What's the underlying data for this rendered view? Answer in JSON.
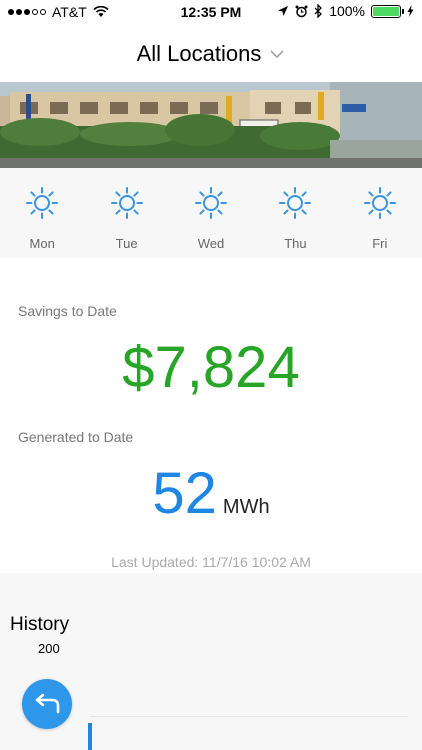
{
  "status_bar": {
    "carrier": "AT&T",
    "time": "12:35 PM",
    "battery": "100%",
    "battery_level": 1.0
  },
  "header": {
    "location": "All Locations",
    "dropdown_icon": "chevron-down-icon"
  },
  "forecast": [
    {
      "day": "Mon",
      "icon": "sun-icon"
    },
    {
      "day": "Tue",
      "icon": "sun-icon"
    },
    {
      "day": "Wed",
      "icon": "sun-icon"
    },
    {
      "day": "Thu",
      "icon": "sun-icon"
    },
    {
      "day": "Fri",
      "icon": "sun-icon"
    }
  ],
  "savings": {
    "label": "Savings to Date",
    "value": "$7,824"
  },
  "generated": {
    "label": "Generated to Date",
    "value": "52",
    "unit": "MWh"
  },
  "last_updated": "Last Updated: 11/7/16 10:02 AM",
  "history": {
    "title": "History",
    "tick": "200"
  },
  "colors": {
    "savings_green": "#27a527",
    "generated_blue": "#1f86e4",
    "fab_blue": "#2f97ea",
    "sun_icon": "#3a94e0",
    "battery_green": "#4cd964"
  }
}
